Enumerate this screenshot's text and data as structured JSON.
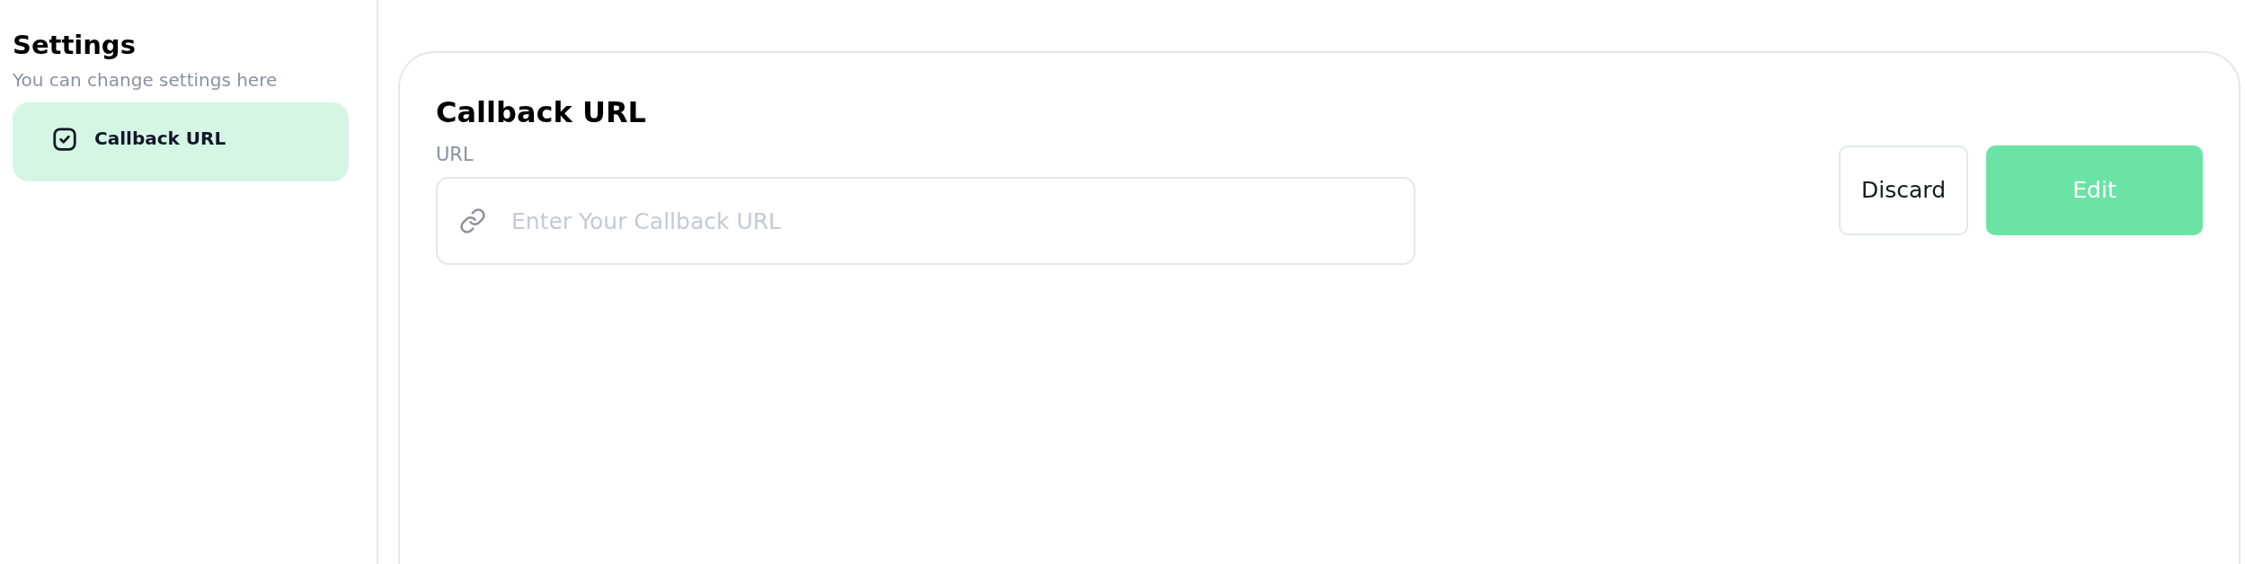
{
  "sidebar": {
    "title": "Settings",
    "subtitle": "You can change settings here",
    "items": [
      {
        "label": "Callback URL",
        "selected": true
      }
    ]
  },
  "panel": {
    "title": "Callback URL",
    "url_field": {
      "label": "URL",
      "placeholder": "Enter Your Callback URL"
    },
    "buttons": [
      {
        "label": "Discard",
        "kind": "secondary"
      },
      {
        "label": "Edit",
        "kind": "primary"
      }
    ]
  }
}
